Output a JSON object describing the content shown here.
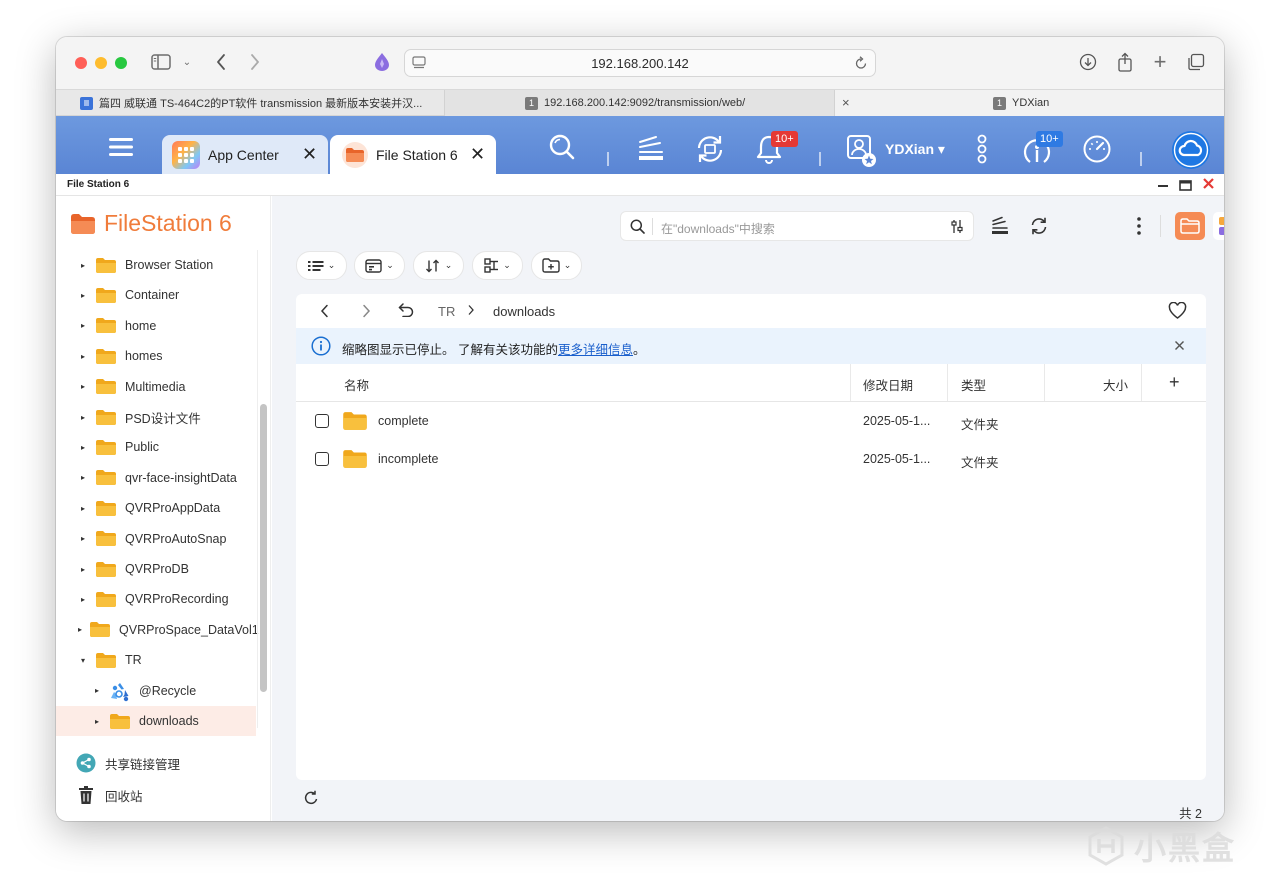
{
  "browser": {
    "url": "192.168.200.142",
    "tabs": [
      {
        "title": "篇四 威联通 TS-464C2的PT软件 transmission 最新版本安装并汉...",
        "favicon": "doc-icon",
        "color": "#3b73d9"
      },
      {
        "title": "192.168.200.142:9092/transmission/web/",
        "favicon": "number-1-icon",
        "favicon_text": "1",
        "color": "#7a7a7a"
      },
      {
        "title": "YDXian",
        "favicon": "number-1-icon",
        "favicon_text": "1",
        "color": "#7a7a7a"
      }
    ]
  },
  "qnap": {
    "apps": [
      {
        "label": "App Center",
        "icon": "app-center-icon",
        "active": false
      },
      {
        "label": "File Station 6",
        "icon": "folder-icon",
        "active": true
      }
    ],
    "user": "YDXian ▾",
    "notif_badge": "10+",
    "update_badge": "10+"
  },
  "app_window": {
    "title": "File Station 6",
    "controls": [
      "minimize",
      "restore",
      "close"
    ]
  },
  "sidebar": {
    "brand": "FileStation 6",
    "folders": [
      {
        "label": "Browser Station",
        "level": 0,
        "caret": "▸",
        "kind": "folder"
      },
      {
        "label": "Container",
        "level": 0,
        "caret": "▸",
        "kind": "folder"
      },
      {
        "label": "home",
        "level": 0,
        "caret": "▸",
        "kind": "folder"
      },
      {
        "label": "homes",
        "level": 0,
        "caret": "▸",
        "kind": "folder"
      },
      {
        "label": "Multimedia",
        "level": 0,
        "caret": "▸",
        "kind": "folder"
      },
      {
        "label": "PSD设计文件",
        "level": 0,
        "caret": "▸",
        "kind": "folder"
      },
      {
        "label": "Public",
        "level": 0,
        "caret": "▸",
        "kind": "folder"
      },
      {
        "label": "qvr-face-insightData",
        "level": 0,
        "caret": "▸",
        "kind": "folder"
      },
      {
        "label": "QVRProAppData",
        "level": 0,
        "caret": "▸",
        "kind": "folder"
      },
      {
        "label": "QVRProAutoSnap",
        "level": 0,
        "caret": "▸",
        "kind": "folder"
      },
      {
        "label": "QVRProDB",
        "level": 0,
        "caret": "▸",
        "kind": "folder"
      },
      {
        "label": "QVRProRecording",
        "level": 0,
        "caret": "▸",
        "kind": "folder"
      },
      {
        "label": "QVRProSpace_DataVol1",
        "level": 0,
        "caret": "▸",
        "kind": "folder"
      },
      {
        "label": "TR",
        "level": 0,
        "caret": "▾",
        "kind": "folder"
      },
      {
        "label": "@Recycle",
        "level": 1,
        "caret": "▸",
        "kind": "recycle"
      },
      {
        "label": "downloads",
        "level": 1,
        "caret": "▸",
        "kind": "folder",
        "selected": true
      }
    ],
    "share_links": "共享链接管理",
    "recycle_bin": "回收站"
  },
  "main": {
    "search_placeholder": "在\"downloads\"中搜索",
    "breadcrumb": {
      "parent": "TR",
      "current": "downloads"
    },
    "info_text": "缩略图显示已停止。 了解有关该功能的",
    "info_link": "更多详细信息",
    "info_end": "。",
    "columns": {
      "name": "名称",
      "modified": "修改日期",
      "type": "类型",
      "size": "大小",
      "add": "+"
    },
    "files": [
      {
        "name": "complete",
        "modified": "2025-05-1...",
        "type": "文件夹"
      },
      {
        "name": "incomplete",
        "modified": "2025-05-1...",
        "type": "文件夹"
      }
    ],
    "total": "共 2"
  },
  "watermark": "小黑盒",
  "colors": {
    "accent": "#f07c3b",
    "qnap_blue": "#5f8bd8",
    "folder": "#f7b733"
  }
}
